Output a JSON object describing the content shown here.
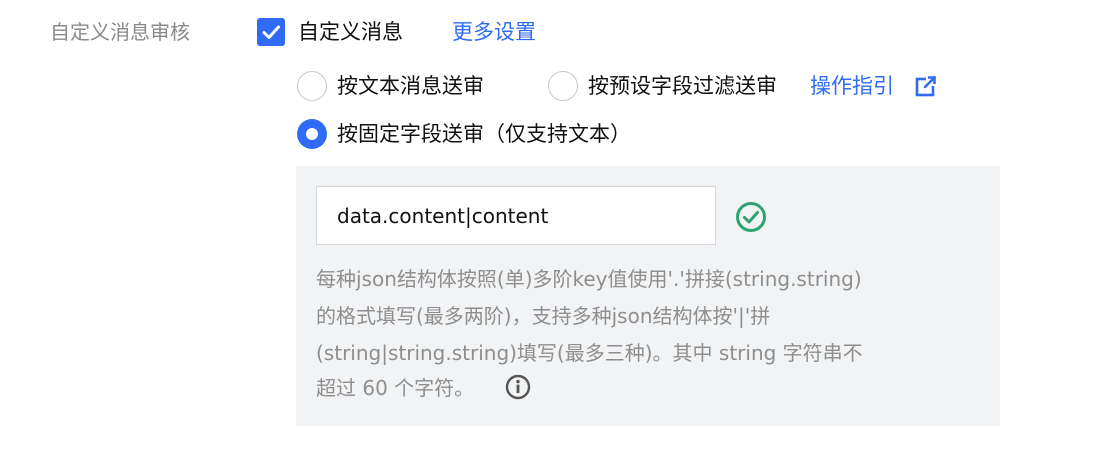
{
  "row": {
    "label": "自定义消息审核",
    "checkbox_label": "自定义消息",
    "checkbox_checked": true,
    "more_settings_link": "更多设置"
  },
  "radios": {
    "option_text": "按文本消息送审",
    "option_preset_fields": "按预设字段过滤送审",
    "guide_link": "操作指引",
    "option_fixed_field": "按固定字段送审（仅支持文本）",
    "selected": "option_fixed_field"
  },
  "panel": {
    "input_value": "data.content|content",
    "input_status_icon": "check-circle-icon",
    "help_lines": [
      "每种json结构体按照(单)多阶key值使用'.'拼接(string.string)",
      "的格式填写(最多两阶)，支持多种json结构体按'|'拼",
      "(string|string.string)填写(最多三种)。其中 string 字符串不",
      "超过 60 个字符。"
    ],
    "info_icon": "info-icon"
  },
  "colors": {
    "accent": "#2f6bf6",
    "success": "#2ba471",
    "muted_text": "#8e8e8e",
    "panel_bg": "#f2f3f5"
  }
}
